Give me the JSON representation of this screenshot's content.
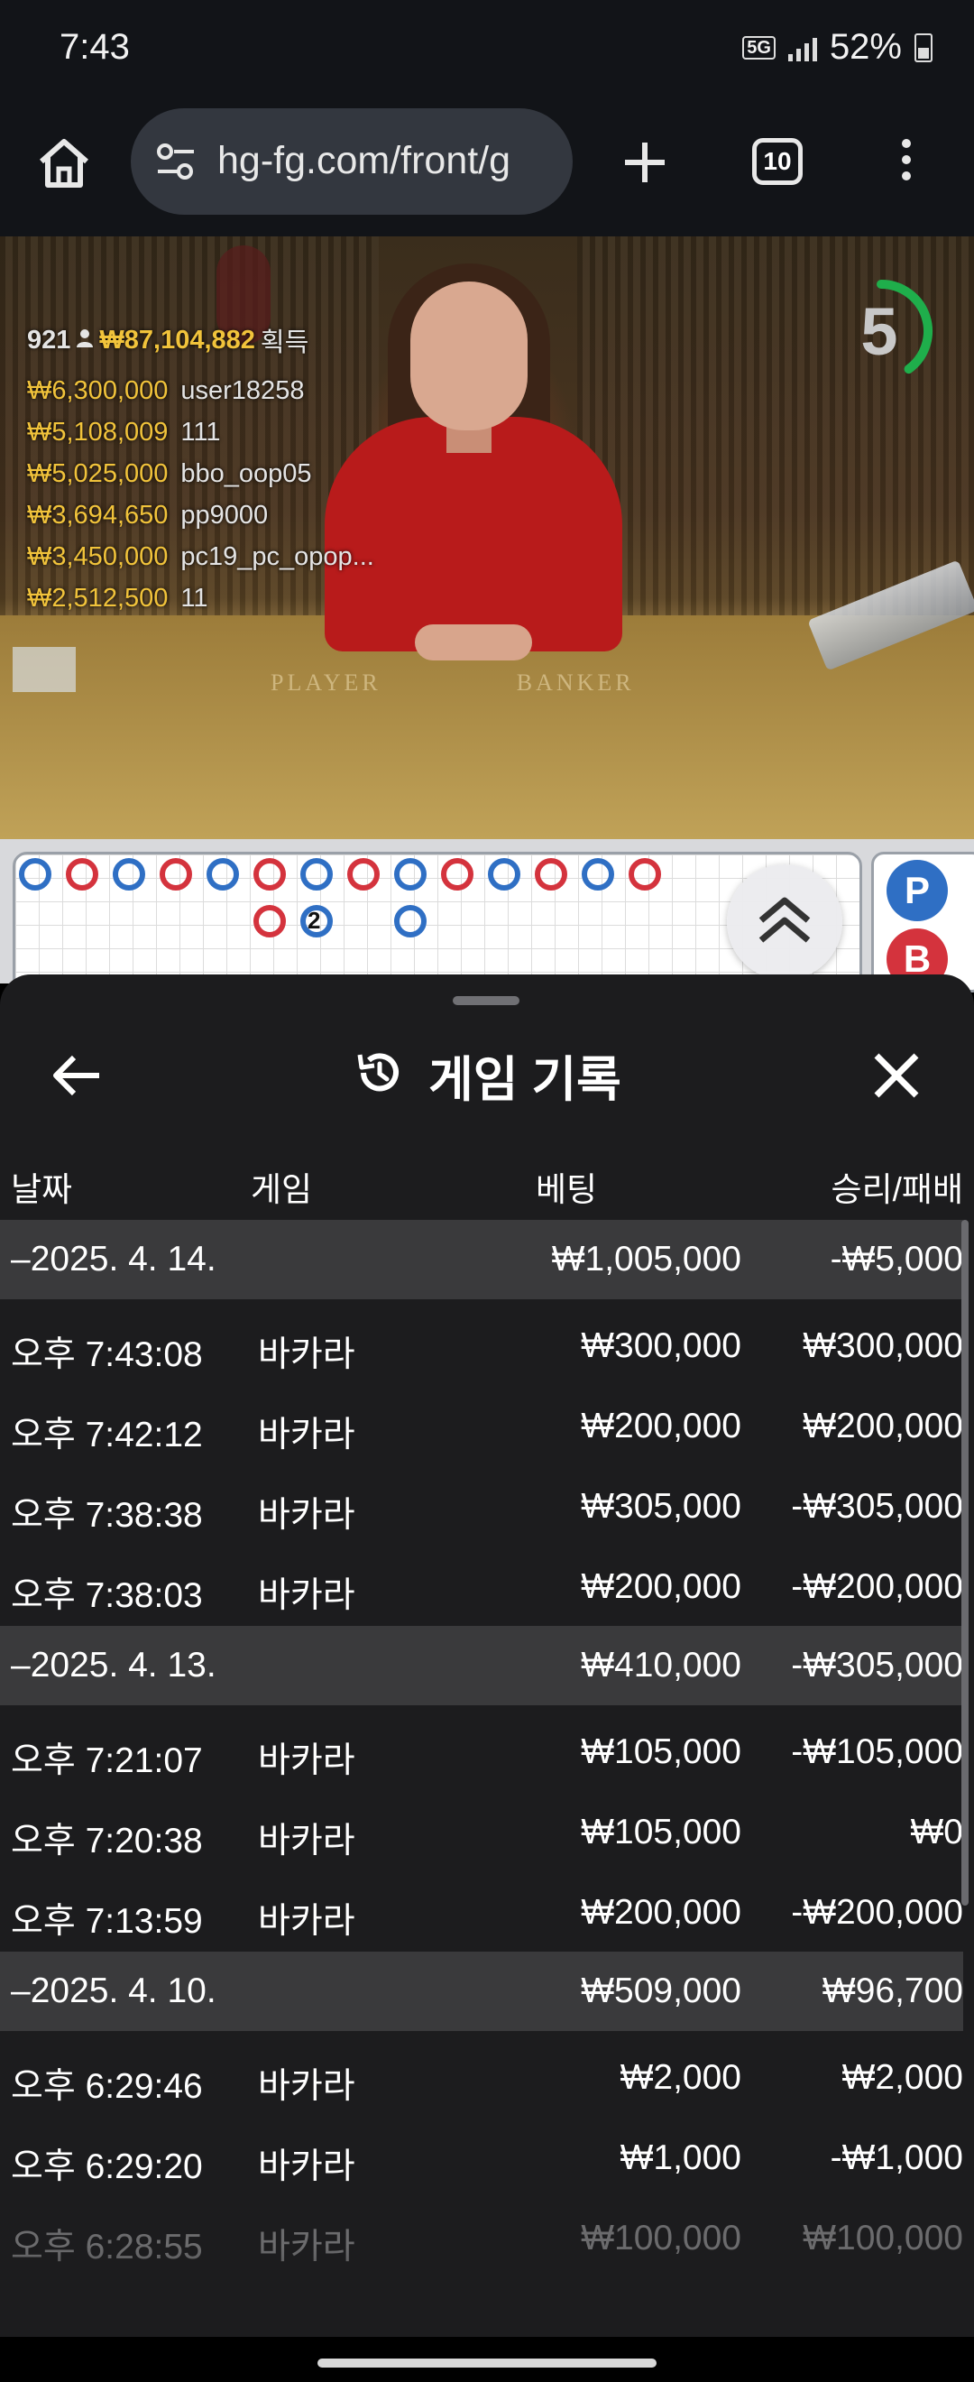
{
  "status_bar": {
    "time": "7:43",
    "network": "5G",
    "battery": "52%"
  },
  "browser": {
    "url": "hg-fg.com/front/g",
    "tab_count": "10",
    "icons": [
      "home-icon",
      "site-settings-icon",
      "new-tab-icon",
      "tab-switcher-icon",
      "more-menu-icon"
    ]
  },
  "stream": {
    "winners_count": "921",
    "winners_total": "₩87,104,882",
    "winners_label": "획득",
    "winners": [
      {
        "amount": "₩6,300,000",
        "user": "user18258"
      },
      {
        "amount": "₩5,108,009",
        "user": "111"
      },
      {
        "amount": "₩5,025,000",
        "user": "bbo_oop05"
      },
      {
        "amount": "₩3,694,650",
        "user": "pp9000"
      },
      {
        "amount": "₩3,450,000",
        "user": "pc19_pc_opop..."
      },
      {
        "amount": "₩2,512,500",
        "user": "11"
      }
    ],
    "table_player_label": "PLAYER",
    "table_banker_label": "BANKER",
    "countdown": "5",
    "countdown_fraction": 0.4
  },
  "roadmap": {
    "row1": [
      "P",
      "B",
      "P",
      "B",
      "P",
      "B",
      "P",
      "B",
      "P",
      "B",
      "P",
      "B",
      "P",
      "B"
    ],
    "row2": [
      {
        "col": 5,
        "r": "B"
      },
      {
        "col": 6,
        "r": "P"
      },
      {
        "col": 8,
        "r": "P"
      }
    ],
    "row2_tie_number": "2",
    "bead_labels": [
      "P",
      "B"
    ],
    "colors": {
      "player": "#2f6fc4",
      "banker": "#d4333d",
      "tie": "#2e9b4c"
    }
  },
  "sheet": {
    "title": "게임 기록",
    "columns": {
      "date": "날짜",
      "game": "게임",
      "bet": "베팅",
      "result": "승리/패배"
    },
    "groups": [
      {
        "date": "–2025. 4. 14.",
        "bet": "₩1,005,000",
        "result": "-₩5,000",
        "rows": [
          {
            "time": "오후 7:43:08",
            "game": "바카라",
            "bet": "₩300,000",
            "result": "₩300,000"
          },
          {
            "time": "오후 7:42:12",
            "game": "바카라",
            "bet": "₩200,000",
            "result": "₩200,000"
          },
          {
            "time": "오후 7:38:38",
            "game": "바카라",
            "bet": "₩305,000",
            "result": "-₩305,000"
          },
          {
            "time": "오후 7:38:03",
            "game": "바카라",
            "bet": "₩200,000",
            "result": "-₩200,000"
          }
        ]
      },
      {
        "date": "–2025. 4. 13.",
        "bet": "₩410,000",
        "result": "-₩305,000",
        "rows": [
          {
            "time": "오후 7:21:07",
            "game": "바카라",
            "bet": "₩105,000",
            "result": "-₩105,000"
          },
          {
            "time": "오후 7:20:38",
            "game": "바카라",
            "bet": "₩105,000",
            "result": "₩0"
          },
          {
            "time": "오후 7:13:59",
            "game": "바카라",
            "bet": "₩200,000",
            "result": "-₩200,000"
          }
        ]
      },
      {
        "date": "–2025. 4. 10.",
        "bet": "₩509,000",
        "result": "₩96,700",
        "rows": [
          {
            "time": "오후 6:29:46",
            "game": "바카라",
            "bet": "₩2,000",
            "result": "₩2,000"
          },
          {
            "time": "오후 6:29:20",
            "game": "바카라",
            "bet": "₩1,000",
            "result": "-₩1,000"
          },
          {
            "time": "오후 6:28:55",
            "game": "바카라",
            "bet": "₩100,000",
            "result": "₩100,000"
          }
        ]
      }
    ]
  }
}
